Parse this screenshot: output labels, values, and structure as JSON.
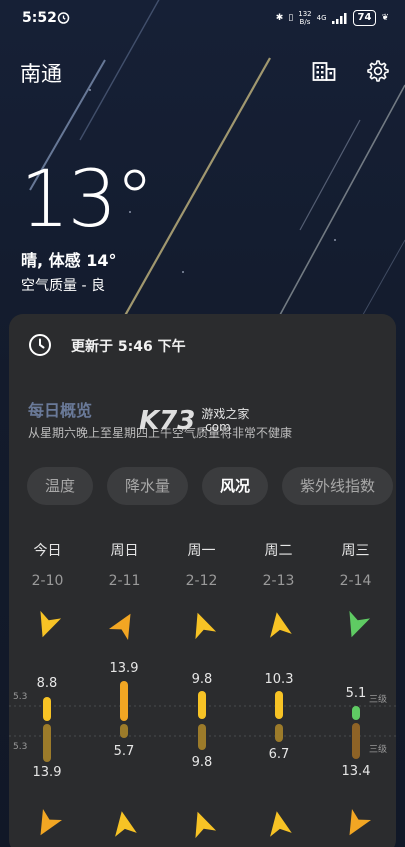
{
  "status_bar": {
    "time": "5:52",
    "net_speed_top": "132",
    "net_speed_bottom": "B/s",
    "network": "4G",
    "battery": "74"
  },
  "header": {
    "city": "南通",
    "buildings_icon": "buildings-icon",
    "settings_icon": "gear-icon"
  },
  "current": {
    "temperature": "13°",
    "condition": "晴, 体感 14°",
    "air_quality": "空气质量 - 良"
  },
  "card": {
    "updated": "更新于 5:46 下午",
    "section_title": "每日概览",
    "section_subtitle": "从星期六晚上至星期四上午空气质量将非常不健康",
    "watermark_logo": "K73",
    "watermark_text": "游戏之家",
    "watermark_url": ".com",
    "tabs": [
      {
        "label": "温度",
        "active": false
      },
      {
        "label": "降水量",
        "active": false
      },
      {
        "label": "风况",
        "active": true
      },
      {
        "label": "紫外线指数",
        "active": false
      }
    ],
    "days": [
      {
        "name": "今日",
        "date": "2-10"
      },
      {
        "name": "周日",
        "date": "2-11"
      },
      {
        "name": "周一",
        "date": "2-12"
      },
      {
        "name": "周二",
        "date": "2-13"
      },
      {
        "name": "周三",
        "date": "2-14"
      }
    ],
    "wind": {
      "day_max": [
        8.8,
        13.9,
        9.8,
        10.3,
        5.1
      ],
      "night_min": [
        13.9,
        5.7,
        9.8,
        6.7,
        13.4
      ],
      "axis_left_top": "5.3",
      "axis_left_bottom": "5.3",
      "level_top": "三级",
      "level_bottom": "三级",
      "colors": {
        "yellow": "#f7c325",
        "orange": "#f2a623",
        "green": "#5fcb63",
        "dark_yellow": "#9c7b2a",
        "dark_orange": "#8e6326"
      }
    }
  }
}
